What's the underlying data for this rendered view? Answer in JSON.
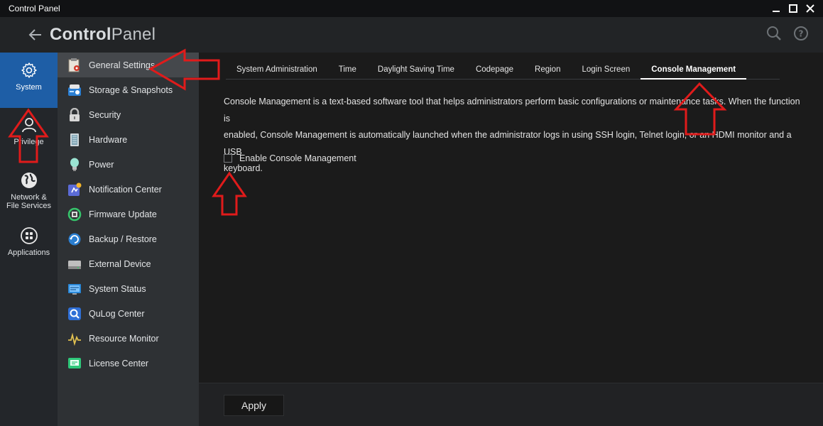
{
  "window": {
    "title": "Control Panel"
  },
  "header": {
    "title_bold": "Control",
    "title_light": "Panel"
  },
  "rail": {
    "items": [
      {
        "label": "System",
        "icon": "gear-icon",
        "active": true
      },
      {
        "label": "Privilege",
        "icon": "user-icon",
        "active": false
      },
      {
        "label_line1": "Network &",
        "label_line2": "File Services",
        "icon": "globe-icon",
        "active": false
      },
      {
        "label": "Applications",
        "icon": "apps-grid-icon",
        "active": false
      }
    ]
  },
  "submenu": {
    "items": [
      {
        "label": "General Settings",
        "icon": "general-settings-icon",
        "active": true
      },
      {
        "label": "Storage & Snapshots",
        "icon": "storage-icon"
      },
      {
        "label": "Security",
        "icon": "lock-icon"
      },
      {
        "label": "Hardware",
        "icon": "hardware-icon"
      },
      {
        "label": "Power",
        "icon": "bulb-icon"
      },
      {
        "label": "Notification Center",
        "icon": "notification-icon"
      },
      {
        "label": "Firmware Update",
        "icon": "firmware-icon"
      },
      {
        "label": "Backup / Restore",
        "icon": "backup-icon"
      },
      {
        "label": "External Device",
        "icon": "external-device-icon"
      },
      {
        "label": "System Status",
        "icon": "system-status-icon"
      },
      {
        "label": "QuLog Center",
        "icon": "qulog-icon"
      },
      {
        "label": "Resource Monitor",
        "icon": "resource-monitor-icon"
      },
      {
        "label": "License Center",
        "icon": "license-icon"
      }
    ]
  },
  "tabs": [
    {
      "label": "System Administration"
    },
    {
      "label": "Time"
    },
    {
      "label": "Daylight Saving Time"
    },
    {
      "label": "Codepage"
    },
    {
      "label": "Region"
    },
    {
      "label": "Login Screen"
    },
    {
      "label": "Console Management",
      "active": true
    }
  ],
  "console": {
    "description_line1": "Console Management is a text-based software tool that helps administrators perform basic configurations or maintenance tasks. When the function is",
    "description_line2": "enabled, Console Management is automatically launched when the administrator logs in using SSH login, Telnet login, or an HDMI monitor and a USB",
    "description_line3": "keyboard.",
    "checkbox_label": "Enable Console Management",
    "checkbox_checked": false
  },
  "footer": {
    "apply_label": "Apply"
  },
  "colors": {
    "accent": "#1e5ea6",
    "annotation_arrow": "#e01b1b"
  }
}
